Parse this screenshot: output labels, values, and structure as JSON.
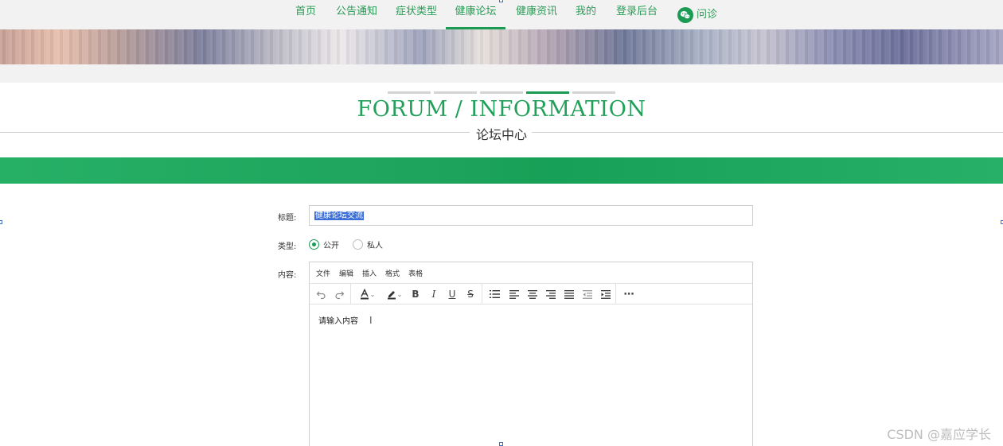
{
  "nav": {
    "items": [
      {
        "label": "首页"
      },
      {
        "label": "公告通知"
      },
      {
        "label": "症状类型"
      },
      {
        "label": "健康论坛"
      },
      {
        "label": "健康资讯"
      },
      {
        "label": "我的"
      },
      {
        "label": "登录后台"
      },
      {
        "label": "问诊",
        "icon": "wechat-icon"
      }
    ],
    "active": "健康论坛",
    "accent_color": "#1a9a52"
  },
  "section": {
    "title": "FORUM / INFORMATION",
    "subtitle": "论坛中心"
  },
  "form": {
    "title_label": "标题:",
    "title_value": "健康论坛交流",
    "type_label": "类型:",
    "type_options": [
      "公开",
      "私人"
    ],
    "type_selected": "公开",
    "content_label": "内容:",
    "editor": {
      "menu": [
        "文件",
        "编辑",
        "插入",
        "格式",
        "表格"
      ],
      "toolbar_icons": [
        "undo-icon",
        "redo-icon",
        "font-color-icon",
        "highlight-icon",
        "bold-icon",
        "italic-icon",
        "underline-icon",
        "strikethrough-icon",
        "numbered-list-icon",
        "align-left-icon",
        "align-center-icon",
        "align-right-icon",
        "align-justify-icon",
        "outdent-icon",
        "indent-icon",
        "more-icon"
      ],
      "placeholder": "请输入内容"
    }
  },
  "watermark": "CSDN @嘉应学长"
}
